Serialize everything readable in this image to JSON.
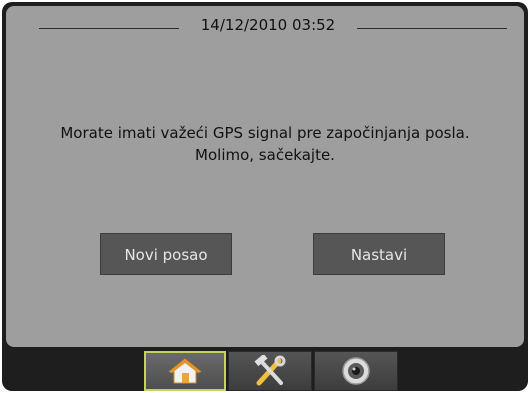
{
  "header": {
    "datetime": "14/12/2010 03:52"
  },
  "message": {
    "line1": "Morate imati važeći GPS signal pre započinjanja posla.",
    "line2": "Molimo, sačekajte."
  },
  "buttons": {
    "new_job": "Novi posao",
    "continue": "Nastavi"
  },
  "tabs": [
    {
      "icon": "home-icon",
      "selected": true
    },
    {
      "icon": "tools-icon",
      "selected": false
    },
    {
      "icon": "camera-icon",
      "selected": false
    }
  ],
  "colors": {
    "panel": "#9e9e9e",
    "button": "#565656",
    "selected_tab_border": "#c6d35a"
  }
}
